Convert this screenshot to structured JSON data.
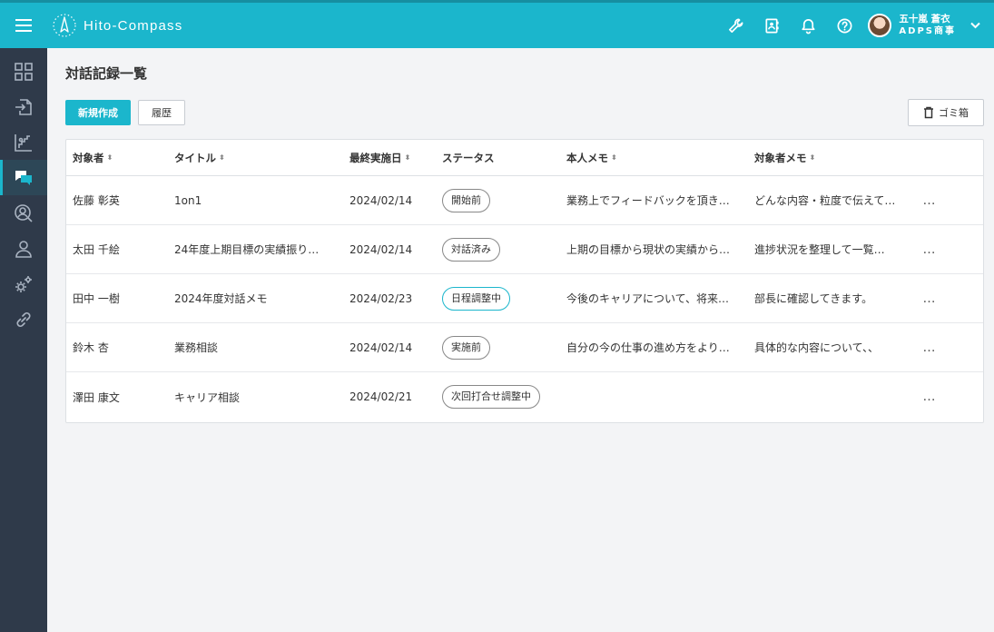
{
  "header": {
    "app_name": "Hito-Compass",
    "user_name": "五十嵐 蒼衣",
    "company": "ADPS商事",
    "accent_color": "#1bb6cc",
    "icons": [
      "menu-icon",
      "wrench-icon",
      "contact-book-icon",
      "bell-icon",
      "help-icon",
      "chevron-down-icon"
    ]
  },
  "sidebar": {
    "items": [
      {
        "icon": "dashboard-icon"
      },
      {
        "icon": "document-export-icon"
      },
      {
        "icon": "growth-chart-icon"
      },
      {
        "icon": "chat-records-icon",
        "active": true
      },
      {
        "icon": "person-search-icon"
      },
      {
        "icon": "user-icon"
      },
      {
        "icon": "settings-gears-icon"
      },
      {
        "icon": "link-icon"
      }
    ]
  },
  "main": {
    "title": "対話記録一覧",
    "new_button": "新規作成",
    "history_button": "履歴",
    "trash_button": "ゴミ箱"
  },
  "table": {
    "headers": {
      "target": "対象者",
      "title": "タイトル",
      "date": "最終実施日",
      "status": "ステータス",
      "self_memo": "本人メモ",
      "target_memo": "対象者メモ"
    },
    "more_label": "…",
    "rows": [
      {
        "target": "佐藤 彰英",
        "title": "1on1",
        "date": "2024/02/14",
        "status": "開始前",
        "self_memo": "業務上でフィードバックを頂き…",
        "target_memo": "どんな内容・粒度で伝えて…"
      },
      {
        "target": "太田 千絵",
        "title": "24年度上期目標の実績振り…",
        "date": "2024/02/14",
        "status": "対話済み",
        "self_memo": "上期の目標から現状の実績から…",
        "target_memo": "進捗状況を整理して一覧…"
      },
      {
        "target": "田中 一樹",
        "title": "2024年度対話メモ",
        "date": "2024/02/23",
        "status": "日程調整中",
        "self_memo": "今後のキャリアについて、将来…",
        "target_memo": "部長に確認してきます。"
      },
      {
        "target": "鈴木 杏",
        "title": "業務相談",
        "date": "2024/02/14",
        "status": "実施前",
        "self_memo": "自分の今の仕事の進め方をより…",
        "target_memo": "具体的な内容について、、"
      },
      {
        "target": "澤田 康文",
        "title": "キャリア相談",
        "date": "2024/02/21",
        "status": "次回打合せ調整中",
        "self_memo": "",
        "target_memo": ""
      }
    ]
  }
}
